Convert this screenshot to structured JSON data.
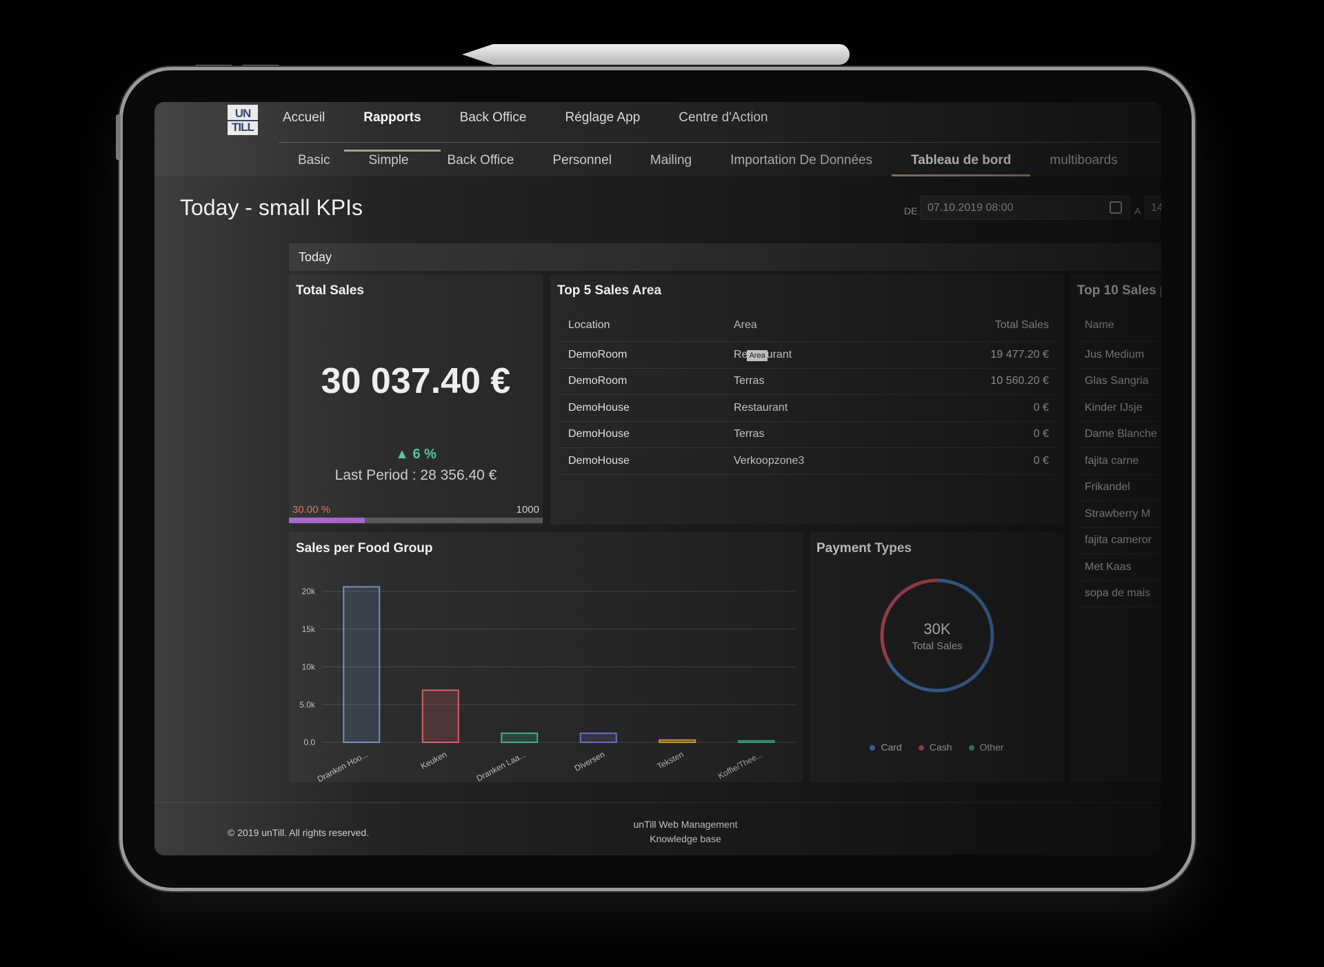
{
  "logo": {
    "line1": "UN",
    "line2": "TILL"
  },
  "nav_main": [
    "Accueil",
    "Rapports",
    "Back Office",
    "Réglage App",
    "Centre d'Action"
  ],
  "nav_main_active": "Rapports",
  "nav_sub": [
    "Basic",
    "Simple",
    "Back Office",
    "Personnel",
    "Mailing",
    "Importation De Données",
    "Tableau de bord",
    "multiboards"
  ],
  "nav_sub_active": "Tableau de bord",
  "page_title": "Today - small KPIs",
  "filter": {
    "from_label": "DE",
    "from_value": "07.10.2019 08:00",
    "to_label": "A",
    "to_value": "14"
  },
  "section_label": "Today",
  "total_sales": {
    "title": "Total Sales",
    "value": "30 037.40 €",
    "change": "6 %",
    "last_period": "Last Period : 28 356.40 €",
    "progress_label": "30.00 %",
    "progress_target": "1000",
    "progress_fraction": 0.3,
    "colors": {
      "up": "#56c29a",
      "progress": "#a25ec9",
      "progress_label": "#e06a4e"
    }
  },
  "top5": {
    "title": "Top 5 Sales Area",
    "headers": [
      "Location",
      "Area",
      "Total Sales"
    ],
    "tooltip": "Area",
    "rows": [
      [
        "DemoRoom",
        "Restaurant",
        "19 477.20 €"
      ],
      [
        "DemoRoom",
        "Terras",
        "10 560.20 €"
      ],
      [
        "DemoHouse",
        "Restaurant",
        "0 €"
      ],
      [
        "DemoHouse",
        "Terras",
        "0 €"
      ],
      [
        "DemoHouse",
        "Verkoopzone3",
        "0 €"
      ]
    ]
  },
  "top10": {
    "title": "Top 10 Sales p",
    "header": "Name",
    "rows": [
      "Jus Medium",
      "Glas Sangria",
      "Kinder IJsje",
      "Dame Blanche",
      "fajita carne",
      "Frikandel",
      "Strawberry M",
      "fajita cameror",
      "Met Kaas",
      "sopa de mais"
    ]
  },
  "food_group": {
    "title": "Sales per Food Group"
  },
  "payment": {
    "title": "Payment Types",
    "center_value": "30K",
    "center_label": "Total Sales",
    "legend": [
      {
        "name": "Card",
        "color": "#4a7fc1"
      },
      {
        "name": "Cash",
        "color": "#d0505f"
      },
      {
        "name": "Other",
        "color": "#3fae88"
      }
    ]
  },
  "chart_data": [
    {
      "type": "bar",
      "title": "Sales per Food Group",
      "categories": [
        "Dranken Hoo...",
        "Keuken",
        "Dranken Laa...",
        "Diversen",
        "Teksten",
        "Koffie/Thee..."
      ],
      "values": [
        20600,
        6900,
        1200,
        1200,
        300,
        200
      ],
      "yticks": [
        "0.0",
        "5.0k",
        "10k",
        "15k",
        "20k"
      ],
      "ylim": [
        0,
        20000
      ],
      "colors": [
        "#6a8bbf",
        "#d75b6a",
        "#3fae88",
        "#6c6fc0",
        "#d6a53a",
        "#3fae88"
      ],
      "grid": true
    },
    {
      "type": "pie",
      "title": "Payment Types",
      "categories": [
        "Card",
        "Cash",
        "Other"
      ],
      "values": [
        67,
        33,
        0
      ],
      "colors": [
        "#4a7fc1",
        "#d0505f",
        "#3fae88"
      ]
    }
  ],
  "footer": {
    "copyright": "© 2019 unTill. All rights reserved.",
    "link1": "unTill Web Management",
    "link2": "Knowledge base"
  }
}
